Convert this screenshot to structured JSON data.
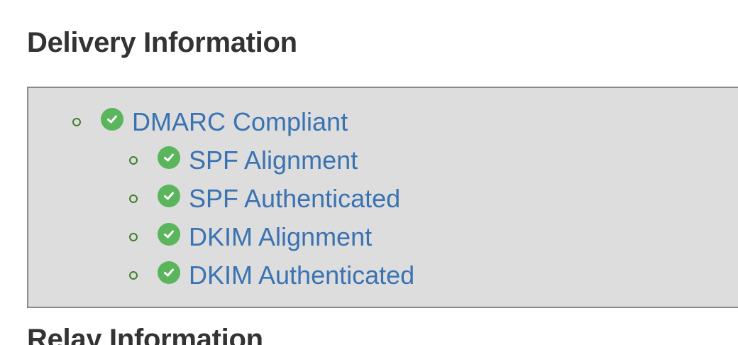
{
  "sections": {
    "delivery_title": "Delivery Information",
    "relay_title": "Relay Information"
  },
  "dmarc": {
    "label": "DMARC Compliant",
    "status_icon": "check-circle-icon",
    "status_color": "#5ab55c",
    "children": [
      {
        "label": "SPF Alignment",
        "status_icon": "check-circle-icon"
      },
      {
        "label": "SPF Authenticated",
        "status_icon": "check-circle-icon"
      },
      {
        "label": "DKIM Alignment",
        "status_icon": "check-circle-icon"
      },
      {
        "label": "DKIM Authenticated",
        "status_icon": "check-circle-icon"
      }
    ]
  },
  "colors": {
    "link": "#3a72b2",
    "panel_background": "#dddddd",
    "panel_border": "#8a8a8a",
    "bullet": "#3f7f2a",
    "heading": "#333333"
  }
}
